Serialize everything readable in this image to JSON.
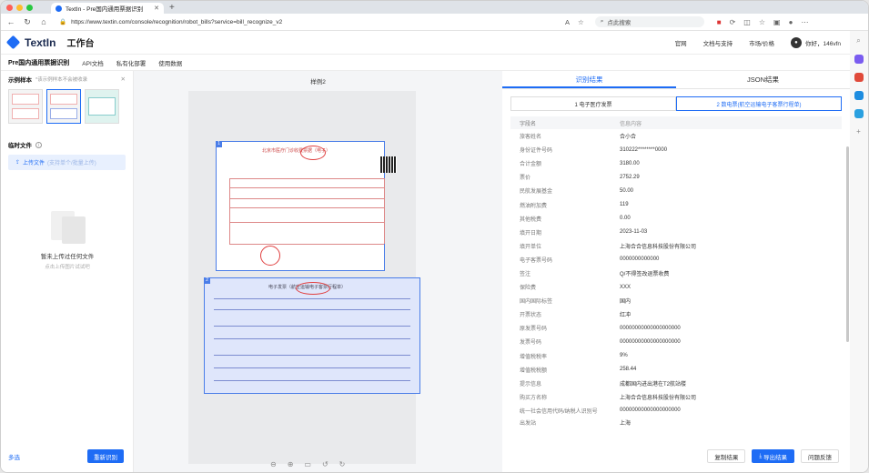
{
  "browser": {
    "tab_title": "TextIn - Pre国内通用票据识别",
    "url": "https://www.textin.com/console/recognition/robot_bills?service=bill_recognize_v2",
    "search_placeholder": "点此搜索",
    "colors": {
      "close": "#ff5f57",
      "min": "#febc2e",
      "max": "#28c840"
    }
  },
  "header": {
    "logo": "TextIn",
    "workspace": "工作台",
    "nav": [
      "官网",
      "文档与支持",
      "市场/价格"
    ],
    "user": "你好，146vfn"
  },
  "subnav": {
    "title": "Pre国内通用票据识别",
    "items": [
      "API文档",
      "私有化部署",
      "使用数据"
    ]
  },
  "left": {
    "sample_title": "示例样本",
    "sample_hint": "*该示例样本不会被收录",
    "temp_title": "临时文件",
    "upload_label": "上传文件",
    "upload_hint": "(支持单个/批量上传)",
    "empty_title": "暂未上传过任何文件",
    "empty_sub": "点击上传图片试试吧",
    "multi": "多选",
    "reco_button": "重新识别"
  },
  "middle": {
    "title": "样例2",
    "invoice1_title": "北京市医疗门诊收费票据（电子）",
    "invoice2_title": "电子发票（航空运输电子客票行程单）"
  },
  "right": {
    "tabs": [
      "识别结果",
      "JSON结果"
    ],
    "segments": [
      "1 电子医疗发票",
      "2 数电票(航空运输电子客票行程单)"
    ],
    "col_headers": [
      "字段名",
      "信息内容"
    ],
    "rows": [
      [
        "旅客姓名",
        "合小合"
      ],
      [
        "身份证件号码",
        "310222********0000"
      ],
      [
        "合计金额",
        "3180.00"
      ],
      [
        "票价",
        "2752.29"
      ],
      [
        "民航发展基金",
        "50.00"
      ],
      [
        "燃油附加费",
        "119"
      ],
      [
        "其他税费",
        "0.00"
      ],
      [
        "填开日期",
        "2023-11-03"
      ],
      [
        "填开单位",
        "上海合合信息科技股份有限公司"
      ],
      [
        "电子客票号码",
        "0000000000000"
      ],
      [
        "签注",
        "Q/不得签改退票收费"
      ],
      [
        "保险费",
        "XXX"
      ],
      [
        "国内国际标签",
        "国内"
      ],
      [
        "开票状态",
        "红冲"
      ],
      [
        "原发票号码",
        "00000000000000000000"
      ],
      [
        "发票号码",
        "00000000000000000000"
      ],
      [
        "增值税税率",
        "9%"
      ],
      [
        "增值税税额",
        "258.44"
      ],
      [
        "提示信息",
        "成都国内进出港在T2航站楼"
      ],
      [
        "购买方名称",
        "上海合合信息科技股份有限公司"
      ],
      [
        "统一社会信用代码/纳税人识别号",
        "00000000000000000000"
      ],
      [
        "出发站",
        "上海"
      ]
    ],
    "buttons": [
      "复制结果",
      "导出结果",
      "问题反馈"
    ]
  }
}
